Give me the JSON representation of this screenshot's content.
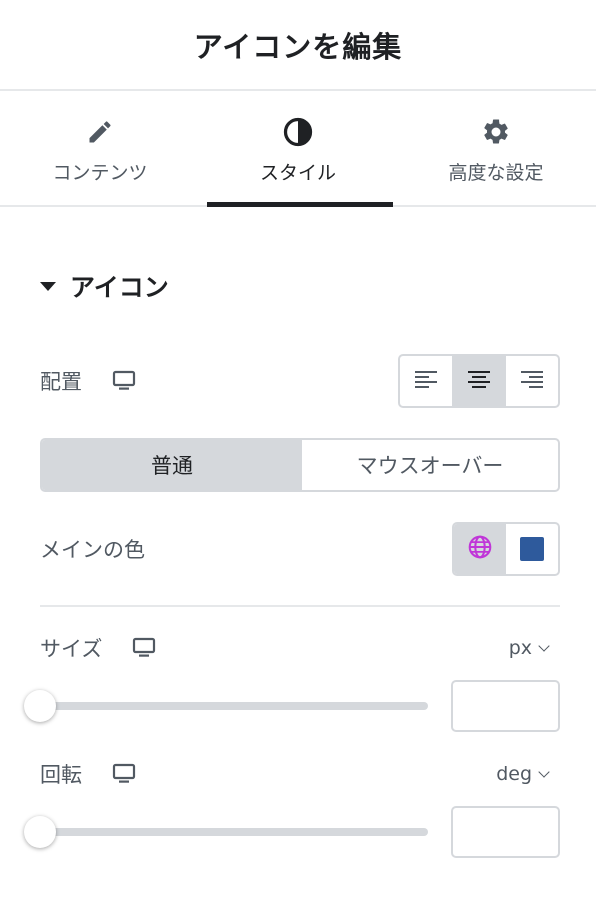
{
  "header": {
    "title": "アイコンを編集"
  },
  "tabs": [
    {
      "label": "コンテンツ",
      "icon": "pencil-icon",
      "active": false
    },
    {
      "label": "スタイル",
      "icon": "contrast-icon",
      "active": true
    },
    {
      "label": "高度な設定",
      "icon": "gear-icon",
      "active": false
    }
  ],
  "section": {
    "title": "アイコン",
    "expanded": true
  },
  "alignment": {
    "label": "配置",
    "device_icon": "desktop-icon",
    "options": [
      "align-left-icon",
      "align-center-icon",
      "align-right-icon"
    ],
    "selected": "center"
  },
  "state_toggle": {
    "normal": "普通",
    "hover": "マウスオーバー",
    "selected": "normal"
  },
  "primary_color": {
    "label": "メインの色",
    "global_icon": "globe-icon",
    "color": "#2e5a9c"
  },
  "size": {
    "label": "サイズ",
    "device_icon": "desktop-icon",
    "unit": "px",
    "value": "",
    "slider_fraction": 0
  },
  "rotate": {
    "label": "回転",
    "device_icon": "desktop-icon",
    "unit": "deg",
    "value": "",
    "slider_fraction": 0
  },
  "colors": {
    "text_dark": "#1f2124",
    "text_muted": "#515962",
    "border": "#d5d8dc",
    "globe": "#c036d8",
    "swatch": "#2e5a9c"
  }
}
